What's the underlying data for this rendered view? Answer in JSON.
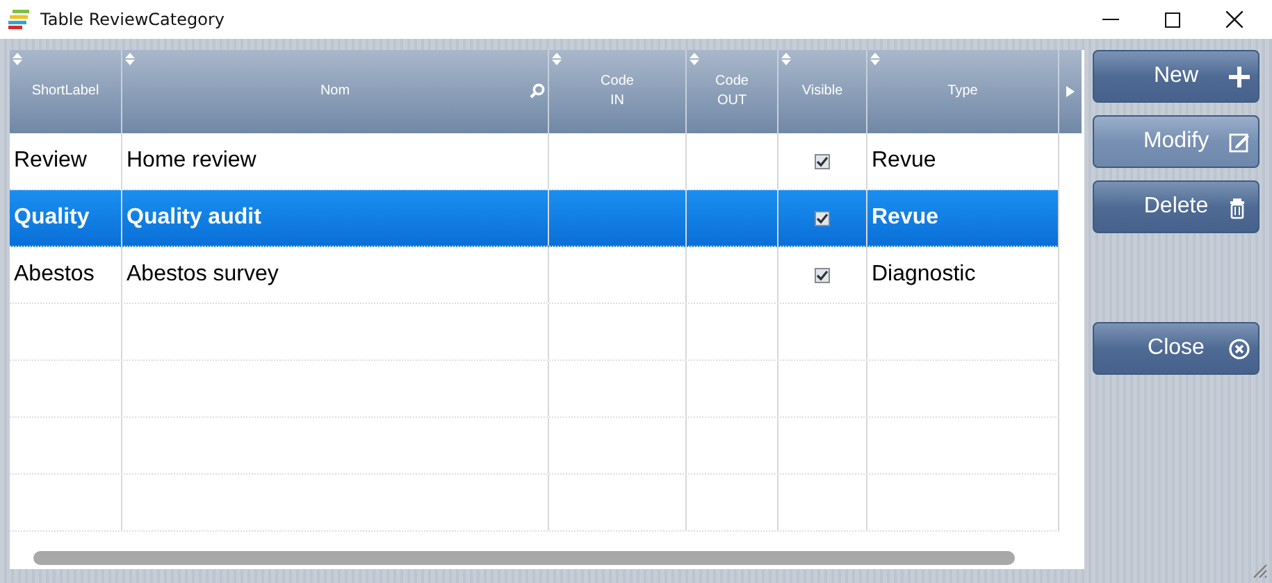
{
  "window": {
    "title": "Table ReviewCategory"
  },
  "table": {
    "columns": [
      {
        "label": "ShortLabel",
        "sortable": true,
        "searchable": false
      },
      {
        "label": "Nom",
        "sortable": true,
        "searchable": true
      },
      {
        "label": "Code\nIN",
        "sortable": true,
        "searchable": false
      },
      {
        "label": "Code\nOUT",
        "sortable": true,
        "searchable": false
      },
      {
        "label": "Visible",
        "sortable": true,
        "searchable": false
      },
      {
        "label": "Type",
        "sortable": true,
        "searchable": false
      }
    ],
    "rows": [
      {
        "short_label": "Review",
        "nom": "Home review",
        "code_in": "",
        "code_out": "",
        "visible": true,
        "type": "Revue",
        "selected": false
      },
      {
        "short_label": "Quality",
        "nom": "Quality audit",
        "code_in": "",
        "code_out": "",
        "visible": true,
        "type": "Revue",
        "selected": true
      },
      {
        "short_label": "Abestos",
        "nom": "Abestos survey",
        "code_in": "",
        "code_out": "",
        "visible": true,
        "type": "Diagnostic",
        "selected": false
      }
    ]
  },
  "buttons": [
    {
      "label": "New",
      "kind": "plus"
    },
    {
      "label": "Modify",
      "kind": "edit"
    },
    {
      "label": "Delete",
      "kind": "trash"
    },
    {
      "label": "Close",
      "kind": "close"
    }
  ]
}
